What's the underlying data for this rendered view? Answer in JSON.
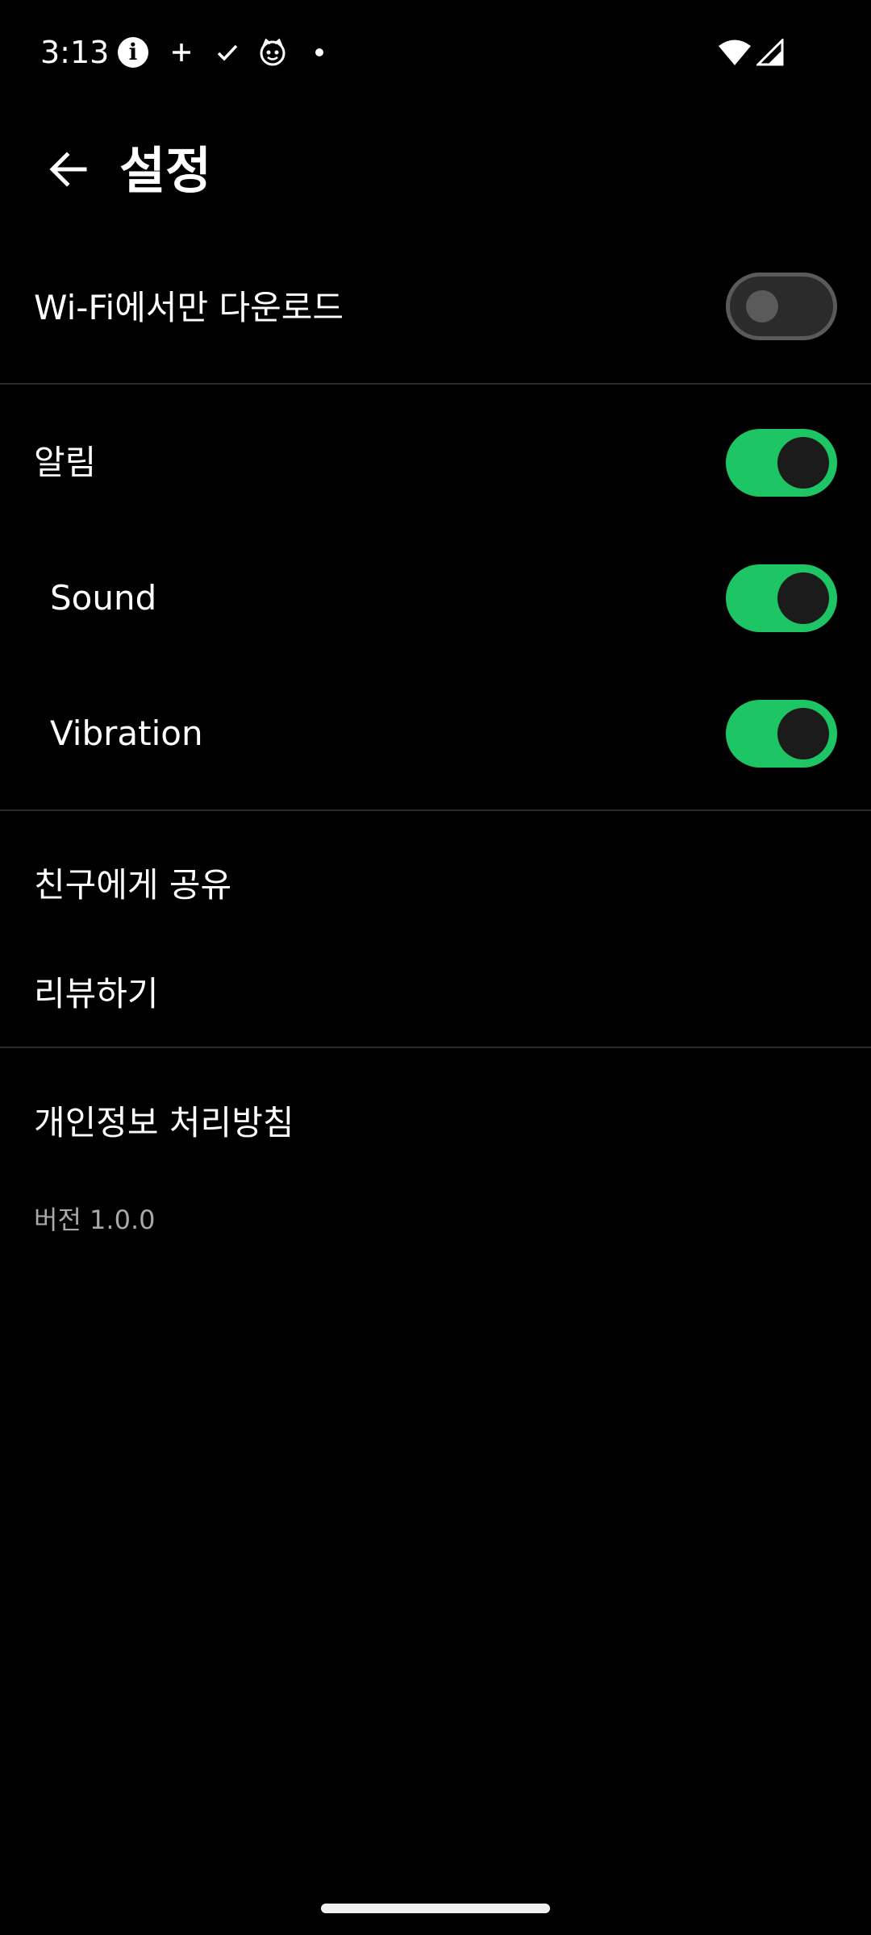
{
  "status_bar": {
    "time": "3:13",
    "icons": [
      "info-icon",
      "plus-icon",
      "check-icon",
      "cat-face-icon",
      "dot-icon",
      "wifi-icon",
      "signal-icon"
    ]
  },
  "header": {
    "back_icon": "arrow-left-icon",
    "title": "설정"
  },
  "settings": {
    "wifi_only": {
      "label": "Wi-Fi에서만 다운로드",
      "enabled": false
    },
    "notifications": {
      "label": "알림",
      "enabled": true
    },
    "sound": {
      "label": "Sound",
      "enabled": true
    },
    "vibration": {
      "label": "Vibration",
      "enabled": true
    }
  },
  "links": {
    "share": "친구에게 공유",
    "review": "리뷰하기",
    "privacy": "개인정보 처리방침"
  },
  "version": "버전 1.0.0",
  "colors": {
    "background": "#000000",
    "toggle_on": "#1ec564",
    "toggle_off_track": "#2b2b2b",
    "divider": "#2a2a2a",
    "version_text": "#a8a8a8"
  }
}
